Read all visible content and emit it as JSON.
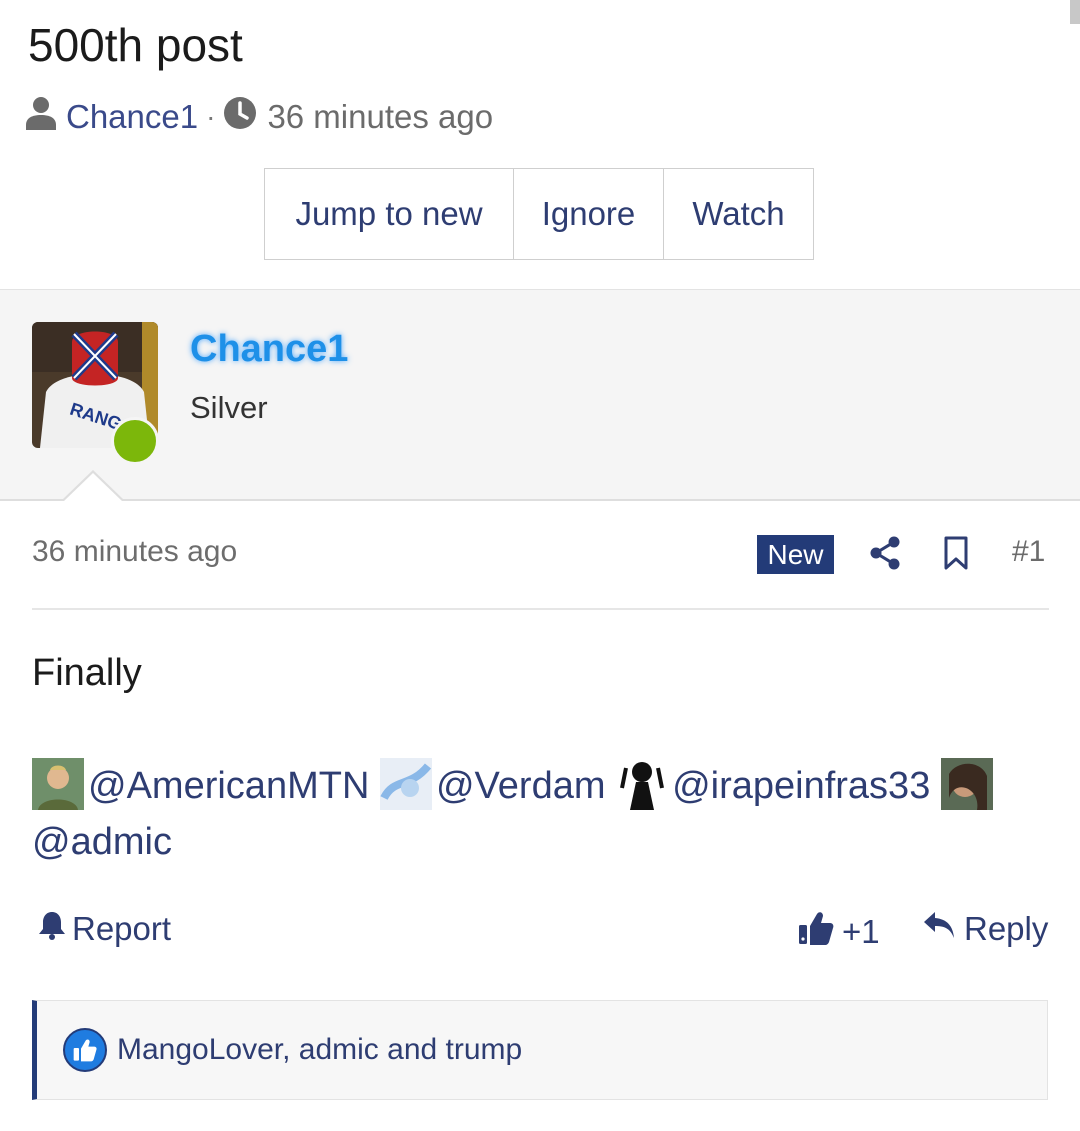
{
  "thread": {
    "title": "500th post",
    "author": "Chance1",
    "time_ago": "36 minutes ago"
  },
  "thread_actions": {
    "jump": "Jump to new",
    "ignore": "Ignore",
    "watch": "Watch"
  },
  "post": {
    "username": "Chance1",
    "rank": "Silver",
    "time_ago": "36 minutes ago",
    "badge": "New",
    "number": "#1",
    "body": "Finally",
    "mentions": [
      "@AmericanMTN",
      "@Verdam",
      "@irapeinfras33",
      "@admic"
    ],
    "report": "Report",
    "like_count": "+1",
    "reply": "Reply",
    "reactions": "MangoLover, admic and trump"
  },
  "colors": {
    "accent": "#233b78",
    "link": "#2e3d72",
    "online": "#7cb70b",
    "username_glow": "#1e90e8"
  }
}
